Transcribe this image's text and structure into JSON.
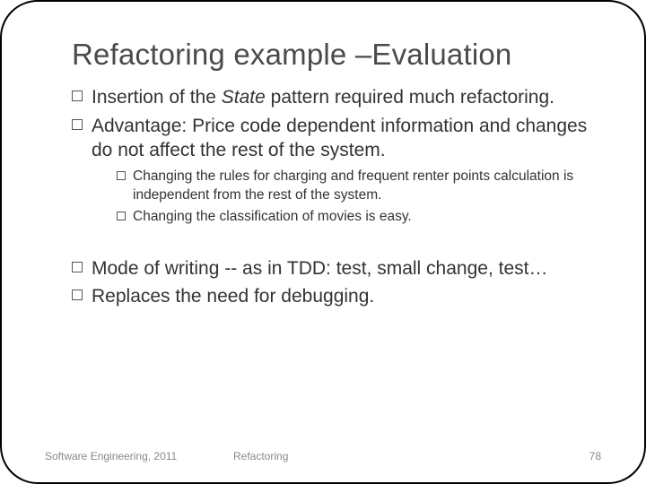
{
  "title": "Refactoring example –Evaluation",
  "bullets": {
    "b1_pre": "Insertion of the ",
    "b1_em": "State",
    "b1_post": " pattern required much refactoring.",
    "b2": "Advantage: Price code dependent information and changes do not affect the rest of the system.",
    "b2_sub": {
      "s1": "Changing the rules for charging and frequent renter points calculation is independent from the rest of the system.",
      "s2": "Changing the classification of movies is easy."
    },
    "b3": "Mode of writing -- as in TDD: test, small change, test…",
    "b4": "Replaces the need for debugging."
  },
  "footer": {
    "left": "Software Engineering, 2011",
    "mid": "Refactoring",
    "page": "78"
  }
}
